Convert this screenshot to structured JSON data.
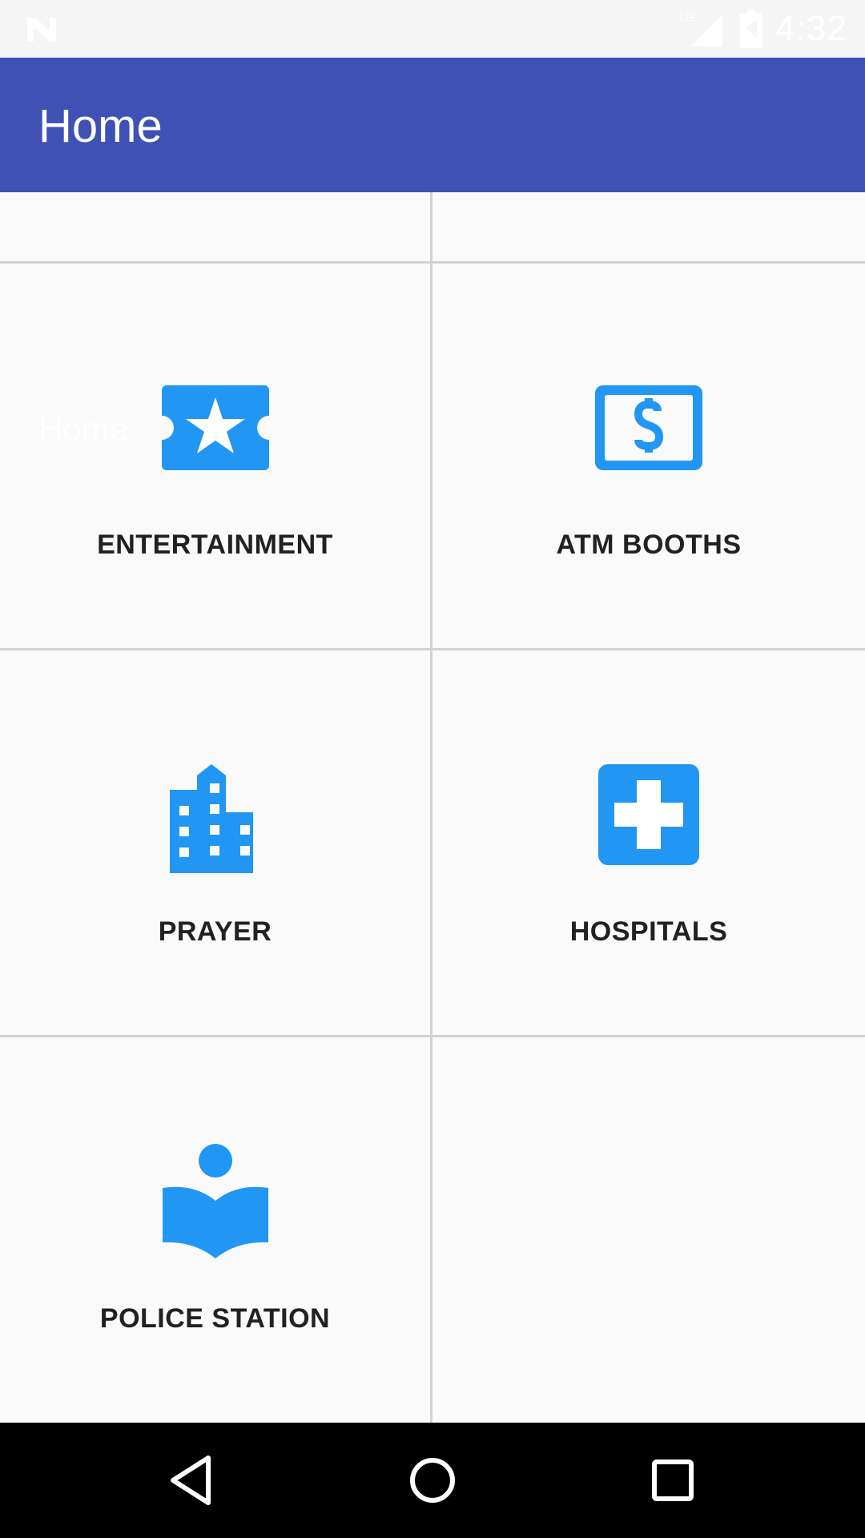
{
  "status_bar": {
    "time": "4:32",
    "network_type": "LTE"
  },
  "app_bar": {
    "title": "Home"
  },
  "overlay_text": "Home",
  "colors": {
    "app_bar": "#3f51b5",
    "icon_blue": "#2196f3",
    "label_text": "#212121",
    "divider": "#d2d2d2",
    "background": "#fafafa",
    "nav_bar": "#000000"
  },
  "categories": [
    {
      "label": "ENTERTAINMENT",
      "icon": "ticket-star-icon"
    },
    {
      "label": "ATM BOOTHS",
      "icon": "dollar-bill-icon"
    },
    {
      "label": "PRAYER",
      "icon": "building-icon"
    },
    {
      "label": "HOSPITALS",
      "icon": "medical-cross-icon"
    },
    {
      "label": "POLICE STATION",
      "icon": "reader-book-icon"
    }
  ],
  "nav_bar": {
    "buttons": [
      "back",
      "home",
      "recents"
    ]
  }
}
